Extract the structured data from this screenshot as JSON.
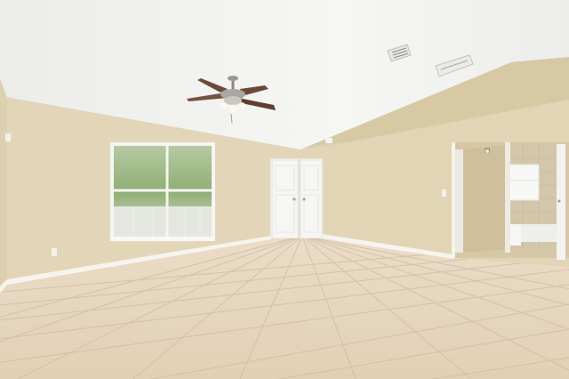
{
  "scene": {
    "description_colors": {
      "ceiling": "#f1f1ef",
      "wall": "#e3d6b8",
      "wall_shade": "#d9cba9",
      "baseboard": "#f7f5ef",
      "floor": "#e6d6c0",
      "grout": "#cdbba1",
      "door": "#f4f4f2",
      "window_frame": "#f5f5f3",
      "bath_tile": "#d3c6aa"
    },
    "icons": [
      "ceiling-fan-icon",
      "air-vent-icon",
      "light-switch-icon",
      "outlet-icon",
      "wall-sconce-icon"
    ]
  }
}
